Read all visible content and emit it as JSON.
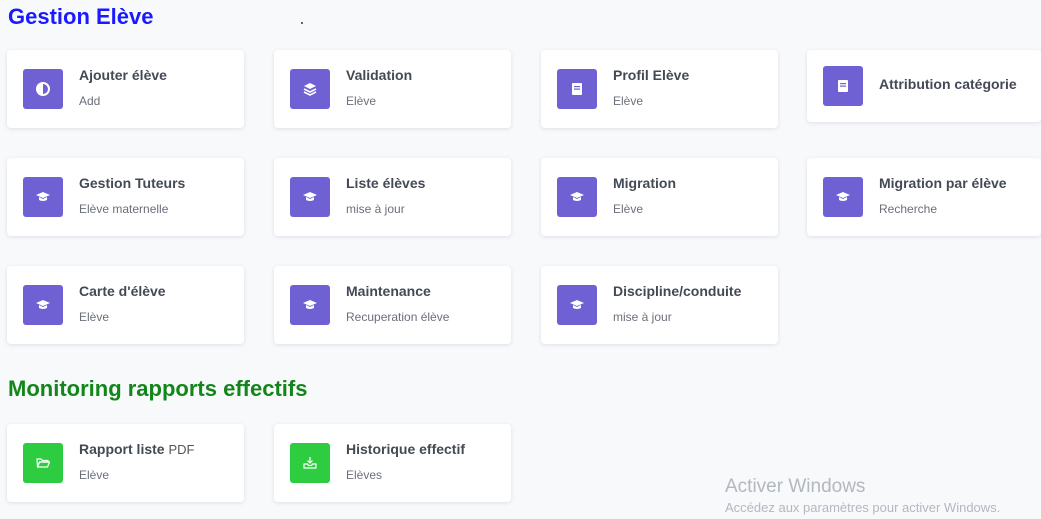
{
  "sections": {
    "gestion_title": "Gestion Elève",
    "monitoring_title": "Monitoring rapports effectifs"
  },
  "cards": {
    "ajouter": {
      "title": "Ajouter élève",
      "sub": "Add",
      "icon": "half-circle-icon"
    },
    "validation": {
      "title": "Validation",
      "sub": "Elève",
      "icon": "layers-icon"
    },
    "profil": {
      "title": "Profil Elève",
      "sub": "Elève",
      "icon": "book-icon"
    },
    "attribution": {
      "title": "Attribution catégorie",
      "icon": "book-icon"
    },
    "tuteurs": {
      "title": "Gestion Tuteurs",
      "sub": "Elève maternelle",
      "icon": "graduation-cap-icon"
    },
    "liste": {
      "title": "Liste élèves",
      "sub": "mise à jour",
      "icon": "graduation-cap-icon"
    },
    "migration": {
      "title": "Migration",
      "sub": "Elève",
      "icon": "graduation-cap-icon"
    },
    "migration_eleve": {
      "title": "Migration par élève",
      "sub": "Recherche",
      "icon": "graduation-cap-icon"
    },
    "carte": {
      "title": "Carte d'élève",
      "sub": "Elève",
      "icon": "graduation-cap-icon"
    },
    "maintenance": {
      "title": "Maintenance",
      "sub": "Recuperation élève",
      "icon": "graduation-cap-icon"
    },
    "discipline": {
      "title": "Discipline/conduite",
      "sub": "mise à jour",
      "icon": "graduation-cap-icon"
    },
    "rapport": {
      "title": "Rapport liste",
      "title_suffix": "PDF",
      "sub": "Elève",
      "icon": "folder-open-icon"
    },
    "historique": {
      "title": "Historique effectif",
      "sub": "Elèves",
      "icon": "inbox-download-icon"
    }
  },
  "colors": {
    "accent": "#6f60d4",
    "green_icon": "#2ecc40",
    "title_blue": "#1a1aff",
    "title_green": "#13861b"
  },
  "watermark": {
    "title": "Activer Windows",
    "sub": "Accédez aux paramètres pour activer Windows."
  }
}
